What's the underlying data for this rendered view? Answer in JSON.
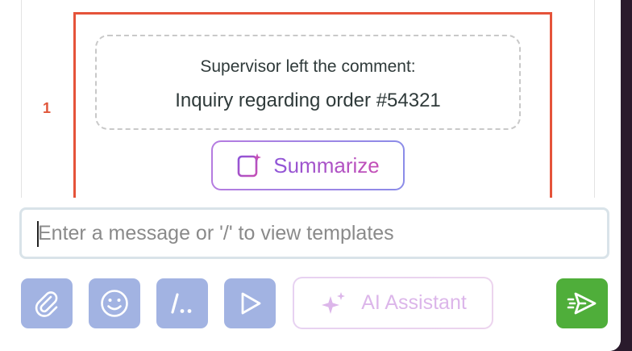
{
  "annotation": {
    "step_number": "1",
    "highlight_color": "#e5533a"
  },
  "comment": {
    "caption": "Supervisor left the comment:",
    "text": "Inquiry regarding order #54321"
  },
  "summarize": {
    "label": "Summarize",
    "icon": "document-sparkle-icon"
  },
  "composer": {
    "placeholder": "Enter a message or '/' to view templates",
    "value": "",
    "tools": [
      {
        "name": "attach",
        "icon": "paperclip-icon"
      },
      {
        "name": "emoji",
        "icon": "smiley-icon"
      },
      {
        "name": "templates",
        "label": "/..",
        "icon": "slash-templates-icon"
      },
      {
        "name": "play",
        "icon": "play-icon"
      }
    ],
    "ai_assistant_label": "AI Assistant",
    "ai_assistant_icon": "sparkles-icon",
    "send_icon": "send-icon"
  },
  "colors": {
    "tool_button_bg": "#a2b3e2",
    "send_button_bg": "#4fae3a",
    "summarize_gradient": [
      "#b57be0",
      "#8b8ce8"
    ],
    "ai_label": "#dcb6ea"
  }
}
